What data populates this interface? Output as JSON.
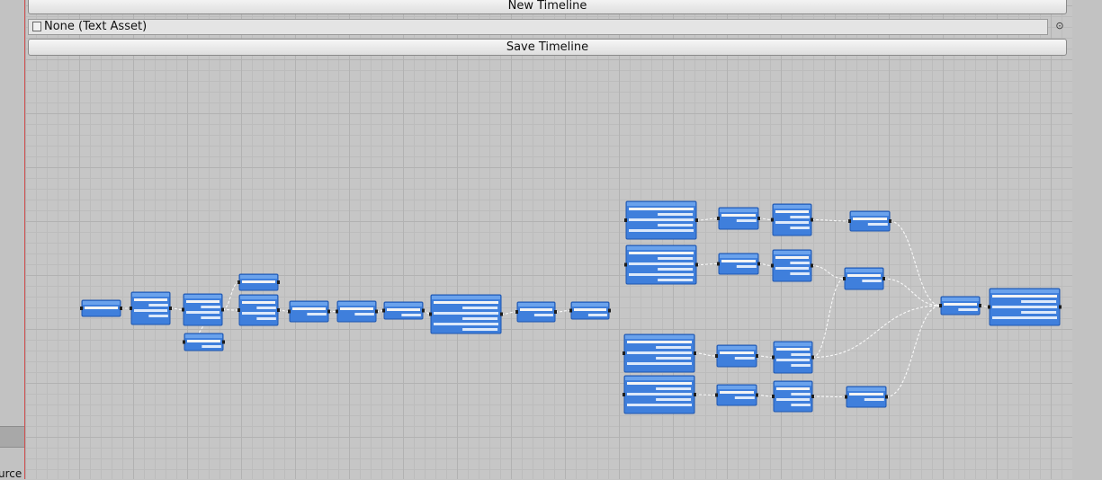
{
  "toolbar": {
    "new_timeline_label": "New Timeline",
    "save_timeline_label": "Save Timeline"
  },
  "asset_field": {
    "value": "None (Text Asset)",
    "picker_icon": "object-picker-icon"
  },
  "left_panel": {
    "clipped_label": "urce"
  },
  "colors": {
    "node_fill": "#3f7fdc",
    "node_border": "#1f57b0",
    "grid_background": "#c6c6c6",
    "connection": "#ffffff"
  },
  "graph": {
    "node_count": 31
  }
}
